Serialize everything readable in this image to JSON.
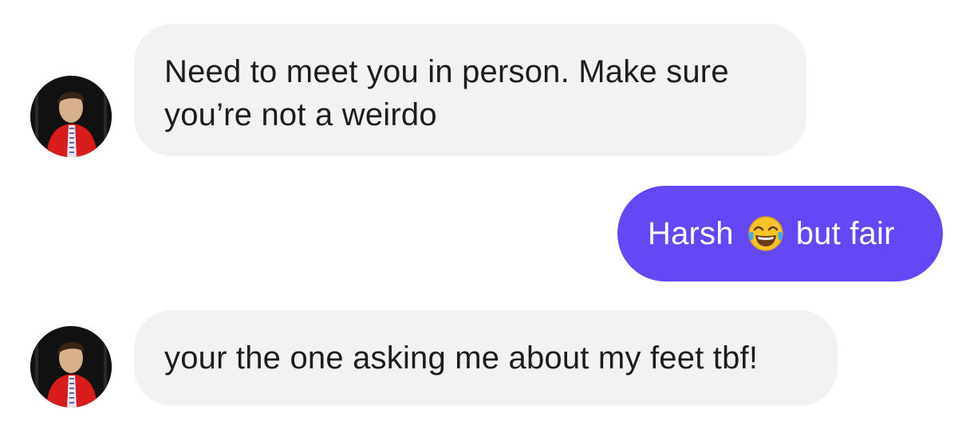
{
  "conversation": {
    "messages": [
      {
        "direction": "incoming",
        "text": "Need to meet you in person. Make sure you’re not a weirdo",
        "avatar": "person-avatar"
      },
      {
        "direction": "outgoing",
        "text_before": "Harsh",
        "emoji": "tears-of-joy-emoji-icon",
        "text_after": "but fair"
      },
      {
        "direction": "incoming",
        "text": "your the one asking me about my feet tbf!",
        "avatar": "person-avatar"
      }
    ]
  },
  "colors": {
    "incoming_bubble": "#f1f2f4",
    "outgoing_bubble": "#6447f5",
    "incoming_text": "#1c1c1e",
    "outgoing_text": "#ffffff"
  }
}
